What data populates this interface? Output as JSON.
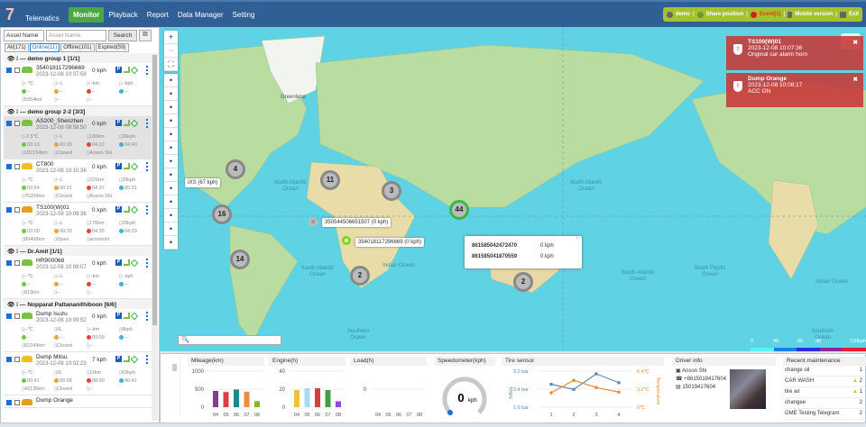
{
  "header": {
    "logo_mark": "7",
    "logo_text": "Telematics",
    "nav": [
      "Monitor",
      "Playback",
      "Report",
      "Data Manager",
      "Setting"
    ],
    "user": "demo",
    "share": "Share position",
    "event": "Event(1)",
    "mobile": "Mobile version",
    "exit": "Exit"
  },
  "search": {
    "field": "Asset Name",
    "placeholder": "Asset Name",
    "button": "Search"
  },
  "tabs": [
    "All(171)",
    "Online(11)",
    "Offline(101)",
    "Expired(59)"
  ],
  "groups": [
    {
      "name": "demo group 1 [1/1]",
      "vehicles": [
        {
          "name": "354018117296669",
          "date": "2023-12-08 10:07:58",
          "speed": "0 kph",
          "stats": [
            "--℃",
            "--L",
            "--km",
            "--kph",
            "--",
            "--",
            "--",
            "--",
            "5954km",
            "--",
            "--"
          ]
        }
      ]
    },
    {
      "name": "demo group 2-2 [3/3]",
      "vehicles": [
        {
          "name": "AS200_Shenzhen",
          "date": "2023-12-08 09:58:50",
          "speed": "0 kph",
          "stats": [
            "-2.5℃",
            "--L",
            "180km",
            "30kph",
            "03:13",
            "00:29",
            "04:22",
            "04:40",
            "182234km",
            "Closed",
            "Anson Shi"
          ]
        },
        {
          "name": "CT800",
          "date": "2023-12-08 10:10:36",
          "speed": "0 kph",
          "stats": [
            "--℃",
            "--L",
            "221km",
            "30kph",
            "03:54",
            "00:31",
            "04:37",
            "05:31",
            "75209km",
            "Closed",
            "Anson Shi"
          ]
        },
        {
          "name": "TS100(W)01",
          "date": "2023-12-08 10:09:36",
          "speed": "0 kph",
          "stats": [
            "--℃",
            "--L",
            "170km",
            "29kph",
            "03:00",
            "00:30",
            "04:35",
            "04:29",
            "80408km",
            "Open",
            "ansonshi"
          ]
        }
      ]
    },
    {
      "name": "Dr.Amit [1/1]",
      "vehicles": [
        {
          "name": "HR900068",
          "date": "2023-12-08 10:08:07",
          "speed": "0 kph",
          "stats": [
            "--℃",
            "--L",
            "--km",
            "--kph",
            "--",
            "--",
            "--",
            "--",
            "813km",
            "--",
            "--"
          ]
        }
      ]
    },
    {
      "name": "Nopparat Pattananithiboon [6/6]",
      "vehicles": [
        {
          "name": "Dump Isuzu",
          "date": "2023-12-08 10:09:52",
          "speed": "0 kph",
          "stats": [
            "--℃",
            "0L",
            "--km",
            "8kph",
            "--",
            "--",
            "09:09",
            "--",
            "82244km",
            "Closed",
            "--"
          ]
        },
        {
          "name": "Dump Mitsu",
          "date": "2023-12-08 10:02:23",
          "speed": "7 kph",
          "stats": [
            "--℃",
            "0L",
            "11km",
            "62kph",
            "00:41",
            "00:08",
            "08:00",
            "00:41",
            "42136km",
            "Closed",
            "--"
          ]
        },
        {
          "name": "Dump Orange",
          "date": "",
          "speed": "",
          "stats": []
        }
      ]
    }
  ],
  "map": {
    "clusters": [
      "4",
      "11",
      "3",
      "44",
      "16",
      "14",
      "2",
      "2"
    ],
    "tags": [
      "IXS (67 kph)",
      "350544506651507 (0 kph)",
      "354018117296669 (0 kph)"
    ],
    "oceans": [
      "North Atlantic Ocean",
      "North Atlantic Ocean",
      "South Atlantic Ocean",
      "South Atlantic Ocean",
      "Indian Ocean",
      "Indian Ocean",
      "South Pacific Ocean",
      "Southern Ocean",
      "Southern Ocean",
      "Greenland"
    ],
    "popup": [
      {
        "id": "861585042472470",
        "speed": "0 kph"
      },
      {
        "id": "861585041870559",
        "speed": "0 kph"
      }
    ],
    "alerts": [
      {
        "title": "TS100(W)01",
        "time": "2023-12-08 10:07:36",
        "msg": "Original car alarm horn"
      },
      {
        "title": "Dump Orange",
        "time": "2023-12-08 10:08:17",
        "msg": "ACC ON"
      }
    ],
    "legend": [
      "0",
      "40",
      "80",
      "90",
      "120kph"
    ],
    "legend_colors": [
      "#5ff0f5",
      "#1a7fe8",
      "#2a2ae0",
      "#8a2a9a",
      "#e81a3a"
    ]
  },
  "chart_data": [
    {
      "type": "bar",
      "title": "Mileage(km)",
      "categories": [
        "04",
        "05",
        "06",
        "07",
        "08"
      ],
      "values": [
        450,
        420,
        490,
        430,
        170
      ],
      "ylim": [
        0,
        1000
      ],
      "yticks": [
        "1000",
        "500",
        "0"
      ],
      "colors": [
        "#8a3a8a",
        "#d84040",
        "#1a8a8a",
        "#f08a40",
        "#8ab81a"
      ]
    },
    {
      "type": "bar",
      "title": "Engine(h)",
      "categories": [
        "04",
        "05",
        "06",
        "07",
        "08"
      ],
      "values": [
        19,
        21,
        21,
        19,
        6.5
      ],
      "ylim": [
        0,
        40
      ],
      "yticks": [
        "40",
        "20",
        "0"
      ],
      "colors": [
        "#f0c040",
        "#a8d8f8",
        "#d04040",
        "#40a040",
        "#a040e0"
      ]
    },
    {
      "type": "bar",
      "title": "Load(h)",
      "categories": [
        "04",
        "05",
        "06",
        "07",
        "08"
      ],
      "values": [],
      "ylim": [
        0,
        0
      ],
      "yticks": [
        "0"
      ],
      "colors": []
    },
    {
      "type": "line",
      "title": "Tire sensor",
      "x": [
        "1",
        "2",
        "3",
        "4"
      ],
      "series": [
        {
          "name": "TPMS",
          "values": [
            2.62,
            2.39,
            3.08,
            2.69
          ],
          "color": "#5a8ab8"
        },
        {
          "name": "Temperature",
          "values": [
            2.56,
            4.77,
            3.49,
            2.68
          ],
          "color": "#f08a30"
        }
      ],
      "yleft": [
        "3.2 bar",
        "2.4 bar",
        "1.6 bar"
      ],
      "yright": [
        "6.4℃",
        "3.2℃",
        "0℃"
      ],
      "ylabel_left": "TPMS",
      "ylabel_right": "Temperature"
    }
  ],
  "speedometer": {
    "title": "Speedometer(kph)",
    "value": "0",
    "unit": "kph"
  },
  "driver": {
    "title": "Driver info",
    "name": "Anson Shi",
    "phone": "+8615019417604",
    "id": "15019417604"
  },
  "maintenance": {
    "title": "Recent maintenance",
    "items": [
      {
        "name": "change oil",
        "count": "1",
        "warn": false
      },
      {
        "name": "CAR WASH",
        "count": "2",
        "warn": true
      },
      {
        "name": "tire air",
        "count": "1",
        "warn": true
      },
      {
        "name": "changee",
        "count": "2",
        "warn": false
      },
      {
        "name": "GME Testing Telegram",
        "count": "2",
        "warn": false
      }
    ]
  }
}
